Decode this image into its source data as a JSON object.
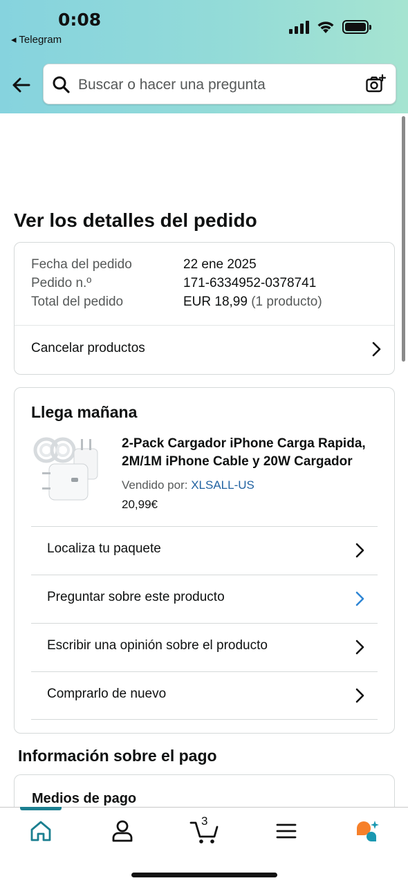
{
  "status_bar": {
    "time": "0:08",
    "back_app": "◂ Telegram"
  },
  "search": {
    "placeholder": "Buscar o hacer una pregunta"
  },
  "page": {
    "title": "Ver los detalles del pedido"
  },
  "order": {
    "date_label": "Fecha del pedido",
    "date_value": "22 ene 2025",
    "number_label": "Pedido n.º",
    "number_value": "171-6334952-0378741",
    "total_label": "Total del pedido",
    "total_value": "EUR 18,99",
    "total_count": "(1 producto)",
    "cancel_label": "Cancelar productos"
  },
  "shipment": {
    "heading": "Llega mañana",
    "product_title": "2-Pack Cargador iPhone Carga Rapida, 2M/1M iPhone Cable y 20W Cargador",
    "sold_by_label": "Vendido por:",
    "seller": "XLSALL-US",
    "price": "20,99€",
    "actions": [
      {
        "label": "Localiza tu paquete"
      },
      {
        "label": "Preguntar sobre este producto"
      },
      {
        "label": "Escribir una opinión sobre el producto"
      },
      {
        "label": "Comprarlo de nuevo"
      }
    ]
  },
  "payment": {
    "heading": "Información sobre el pago",
    "methods_label": "Medios de pago"
  },
  "nav": {
    "cart_count": "3",
    "items": [
      {
        "icon": "home-icon",
        "active": true
      },
      {
        "icon": "person-icon"
      },
      {
        "icon": "cart-icon"
      },
      {
        "icon": "menu-icon"
      },
      {
        "icon": "rufus-icon"
      }
    ]
  },
  "colors": {
    "accent": "#1b7f90",
    "link": "#2162a1",
    "chevron_blue": "#2f86d4",
    "rufus_orange": "#f6802a",
    "rufus_teal": "#1a98b1"
  }
}
